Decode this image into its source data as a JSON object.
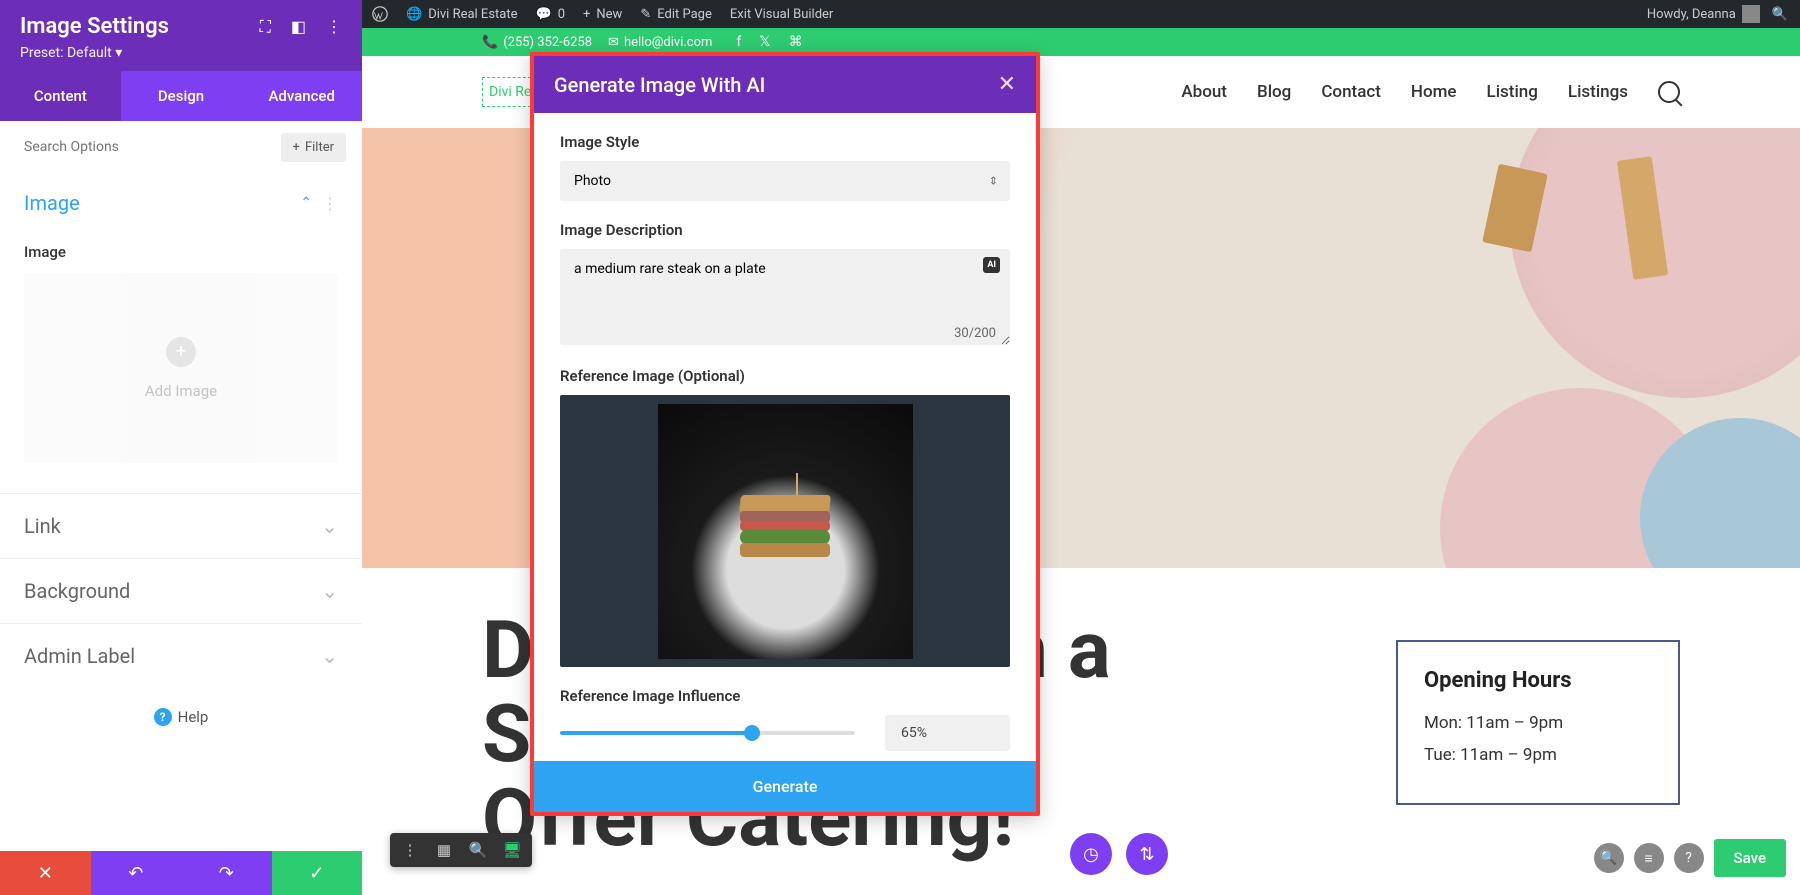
{
  "wp_bar": {
    "site": "Divi Real Estate",
    "comments": "0",
    "new": "New",
    "edit": "Edit Page",
    "exit": "Exit Visual Builder",
    "howdy": "Howdy, Deanna"
  },
  "contact": {
    "phone": "(255) 352-6258",
    "email": "hello@divi.com"
  },
  "site_nav": {
    "logo": "Divi Real Estate",
    "items": [
      "About",
      "Blog",
      "Contact",
      "Home",
      "Listing",
      "Listings"
    ]
  },
  "hero": {
    "headline_part": "Di\nSp\nOffer Catering!"
  },
  "hours": {
    "title": "Opening Hours",
    "rows": [
      "Mon: 11am – 9pm",
      "Tue: 11am – 9pm"
    ]
  },
  "settings": {
    "title": "Image Settings",
    "preset": "Preset: Default",
    "tabs": [
      "Content",
      "Design",
      "Advanced"
    ],
    "search_placeholder": "Search Options",
    "filter": "Filter",
    "section_image": "Image",
    "image_label": "Image",
    "add_image": "Add Image",
    "collapsed": [
      "Link",
      "Background",
      "Admin Label"
    ],
    "help": "Help"
  },
  "ai_modal": {
    "title": "Generate Image With AI",
    "style_label": "Image Style",
    "style_value": "Photo",
    "desc_label": "Image Description",
    "desc_value": "a medium rare steak on a plate",
    "char_count": "30/200",
    "ai_badge": "AI",
    "ref_label": "Reference Image (Optional)",
    "influence_label": "Reference Image Influence",
    "influence_value": "65%",
    "generate": "Generate"
  },
  "save_bar": {
    "save": "Save"
  }
}
